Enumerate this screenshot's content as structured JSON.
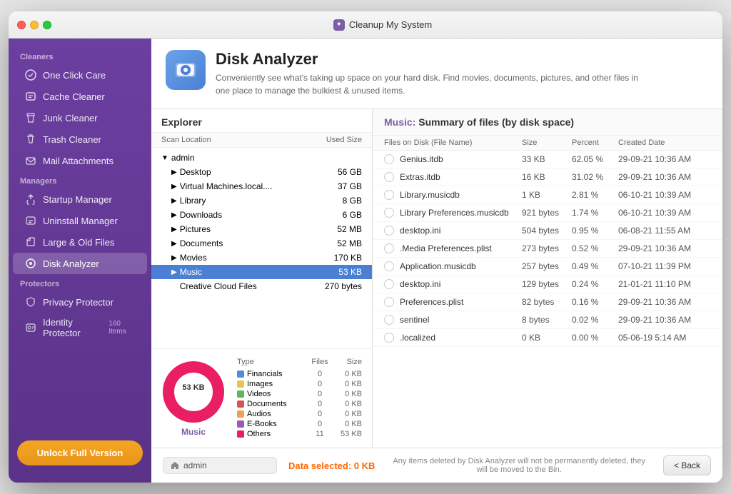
{
  "window": {
    "title": "Cleanup My System"
  },
  "sidebar": {
    "cleaners_title": "Cleaners",
    "managers_title": "Managers",
    "protectors_title": "Protectors",
    "items": {
      "one_click_care": "One Click Care",
      "cache_cleaner": "Cache Cleaner",
      "junk_cleaner": "Junk Cleaner",
      "trash_cleaner": "Trash Cleaner",
      "mail_attachments": "Mail Attachments",
      "startup_manager": "Startup Manager",
      "uninstall_manager": "Uninstall Manager",
      "large_old_files": "Large & Old Files",
      "disk_analyzer": "Disk Analyzer",
      "privacy_protector": "Privacy Protector",
      "identity_protector": "Identity Protector",
      "identity_badge": "160 Items"
    },
    "unlock_label": "Unlock Full Version"
  },
  "app_header": {
    "title": "Disk Analyzer",
    "description": "Conveniently see what's taking up space on your hard disk. Find movies, documents, pictures, and other files in one place to manage the bulkiest & unused items."
  },
  "explorer": {
    "title": "Explorer",
    "col_scan": "Scan Location",
    "col_size": "Used Size",
    "root": "admin",
    "items": [
      {
        "label": "Desktop",
        "size": "56 GB",
        "indent": 1,
        "arrow": true
      },
      {
        "label": "Virtual Machines.local....",
        "size": "37 GB",
        "indent": 1,
        "arrow": true
      },
      {
        "label": "Library",
        "size": "8 GB",
        "indent": 1,
        "arrow": true
      },
      {
        "label": "Downloads",
        "size": "6 GB",
        "indent": 1,
        "arrow": true
      },
      {
        "label": "Pictures",
        "size": "52 MB",
        "indent": 1,
        "arrow": true
      },
      {
        "label": "Documents",
        "size": "52 MB",
        "indent": 1,
        "arrow": true
      },
      {
        "label": "Movies",
        "size": "170 KB",
        "indent": 1,
        "arrow": true
      },
      {
        "label": "Music",
        "size": "53 KB",
        "indent": 1,
        "arrow": true,
        "selected": true
      },
      {
        "label": "Creative Cloud Files",
        "size": "270 bytes",
        "indent": 1,
        "arrow": false
      }
    ]
  },
  "chart": {
    "label": "53 KB",
    "folder_name": "Music",
    "legend": {
      "headers": [
        "Type",
        "Files",
        "Size"
      ],
      "rows": [
        {
          "color": "#4a90d9",
          "type": "Financials",
          "files": "0",
          "size": "0 KB"
        },
        {
          "color": "#e8c44a",
          "type": "Images",
          "files": "0",
          "size": "0 KB"
        },
        {
          "color": "#5bb85b",
          "type": "Videos",
          "files": "0",
          "size": "0 KB"
        },
        {
          "color": "#d9534f",
          "type": "Documents",
          "files": "0",
          "size": "0 KB"
        },
        {
          "color": "#f0a050",
          "type": "Audios",
          "files": "0",
          "size": "0 KB"
        },
        {
          "color": "#9b59b6",
          "type": "E-Books",
          "files": "0",
          "size": "0 KB"
        },
        {
          "color": "#e91e63",
          "type": "Others",
          "files": "11",
          "size": "53 KB"
        }
      ]
    }
  },
  "details": {
    "header": "Music: Summary of files (by disk space)",
    "header_colored": "Music:",
    "header_plain": "Summary of files (by disk space)",
    "cols": {
      "name": "Files on Disk (File Name)",
      "size": "Size",
      "pct": "Percent",
      "date": "Created Date"
    },
    "rows": [
      {
        "name": "Genius.itdb",
        "size": "33 KB",
        "pct": "62.05 %",
        "date": "29-09-21 10:36 AM"
      },
      {
        "name": "Extras.itdb",
        "size": "16 KB",
        "pct": "31.02 %",
        "date": "29-09-21 10:36 AM"
      },
      {
        "name": "Library.musicdb",
        "size": "1 KB",
        "pct": "2.81 %",
        "date": "06-10-21 10:39 AM"
      },
      {
        "name": "Library Preferences.musicdb",
        "size": "921 bytes",
        "pct": "1.74 %",
        "date": "06-10-21 10:39 AM"
      },
      {
        "name": "desktop.ini",
        "size": "504 bytes",
        "pct": "0.95 %",
        "date": "06-08-21 11:55 AM"
      },
      {
        "name": ".Media Preferences.plist",
        "size": "273 bytes",
        "pct": "0.52 %",
        "date": "29-09-21 10:36 AM"
      },
      {
        "name": "Application.musicdb",
        "size": "257 bytes",
        "pct": "0.49 %",
        "date": "07-10-21 11:39 PM"
      },
      {
        "name": "desktop.ini",
        "size": "129 bytes",
        "pct": "0.24 %",
        "date": "21-01-21 11:10 PM"
      },
      {
        "name": "Preferences.plist",
        "size": "82 bytes",
        "pct": "0.16 %",
        "date": "29-09-21 10:36 AM"
      },
      {
        "name": "sentinel",
        "size": "8 bytes",
        "pct": "0.02 %",
        "date": "29-09-21 10:36 AM"
      },
      {
        "name": ".localized",
        "size": "0 KB",
        "pct": "0.00 %",
        "date": "05-06-19 5:14 AM"
      }
    ]
  },
  "bottom_bar": {
    "breadcrumb": "admin",
    "data_selected_label": "Data selected:",
    "data_selected_value": "0 KB",
    "info_text": "Any items deleted by Disk Analyzer will not be permanently deleted, they will be moved to the Bin.",
    "back_label": "< Back"
  }
}
